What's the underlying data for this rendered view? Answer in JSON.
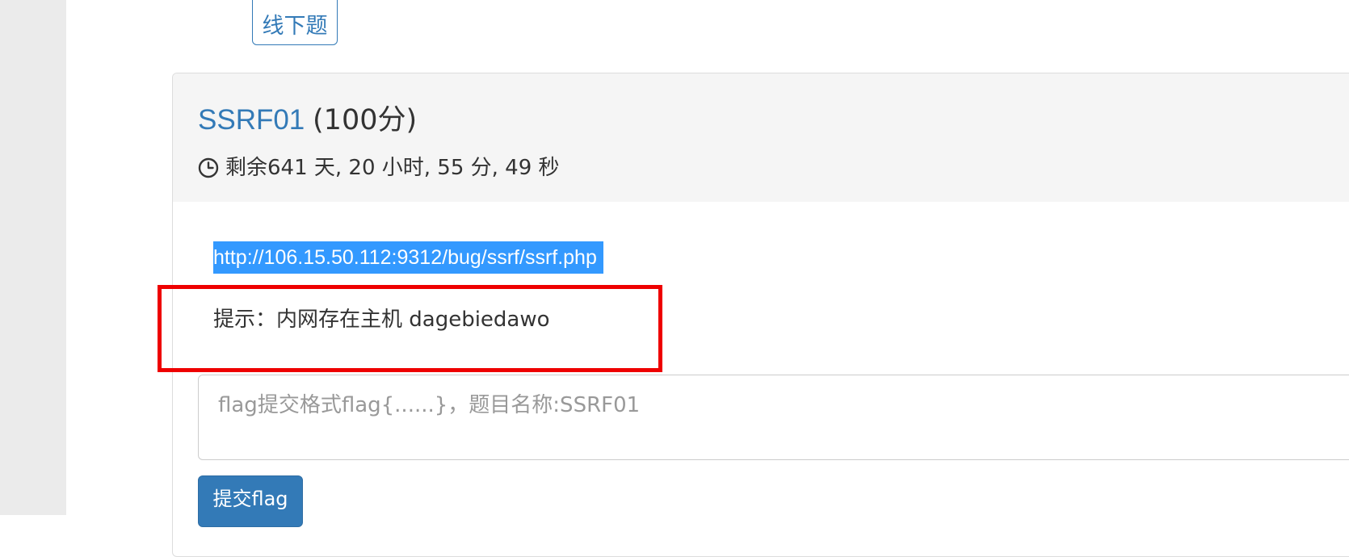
{
  "category_tag": "线下题",
  "challenge": {
    "name": "SSRF01",
    "score": "(100分)",
    "countdown": "剩余641 天, 20 小时, 55 分, 49 秒",
    "url": "http://106.15.50.112:9312/bug/ssrf/ssrf.php",
    "hint": "提示：内网存在主机 dagebiedawo"
  },
  "flag_form": {
    "placeholder": "flag提交格式flag{......}，题目名称:SSRF01",
    "value": "",
    "submit_label": "提交flag"
  },
  "colors": {
    "link_blue": "#337ab7",
    "selection_highlight": "#3399ff",
    "annotation_red": "#ee0000",
    "heading_bg": "#f5f5f5"
  }
}
